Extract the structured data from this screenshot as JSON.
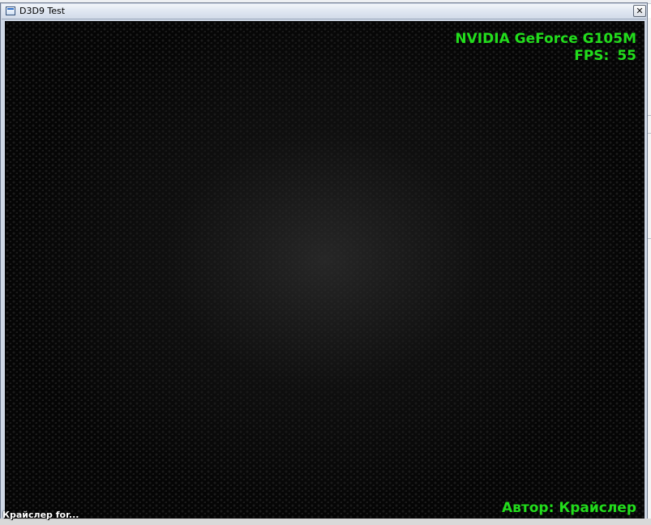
{
  "window": {
    "title": "D3D9 Test",
    "close_glyph": "✕",
    "icon": "app-window-icon"
  },
  "hud": {
    "gpu_name": "NVIDIA GeForce G105M",
    "fps_label": "FPS:",
    "fps_value": "55",
    "author": "Автор: Крайслер"
  },
  "taskbar": {
    "label": "Крайслер for..."
  },
  "colors": {
    "hud_text": "#22dd1c",
    "viewport_bg": "#050505",
    "titlebar": "#dfe6f1"
  }
}
